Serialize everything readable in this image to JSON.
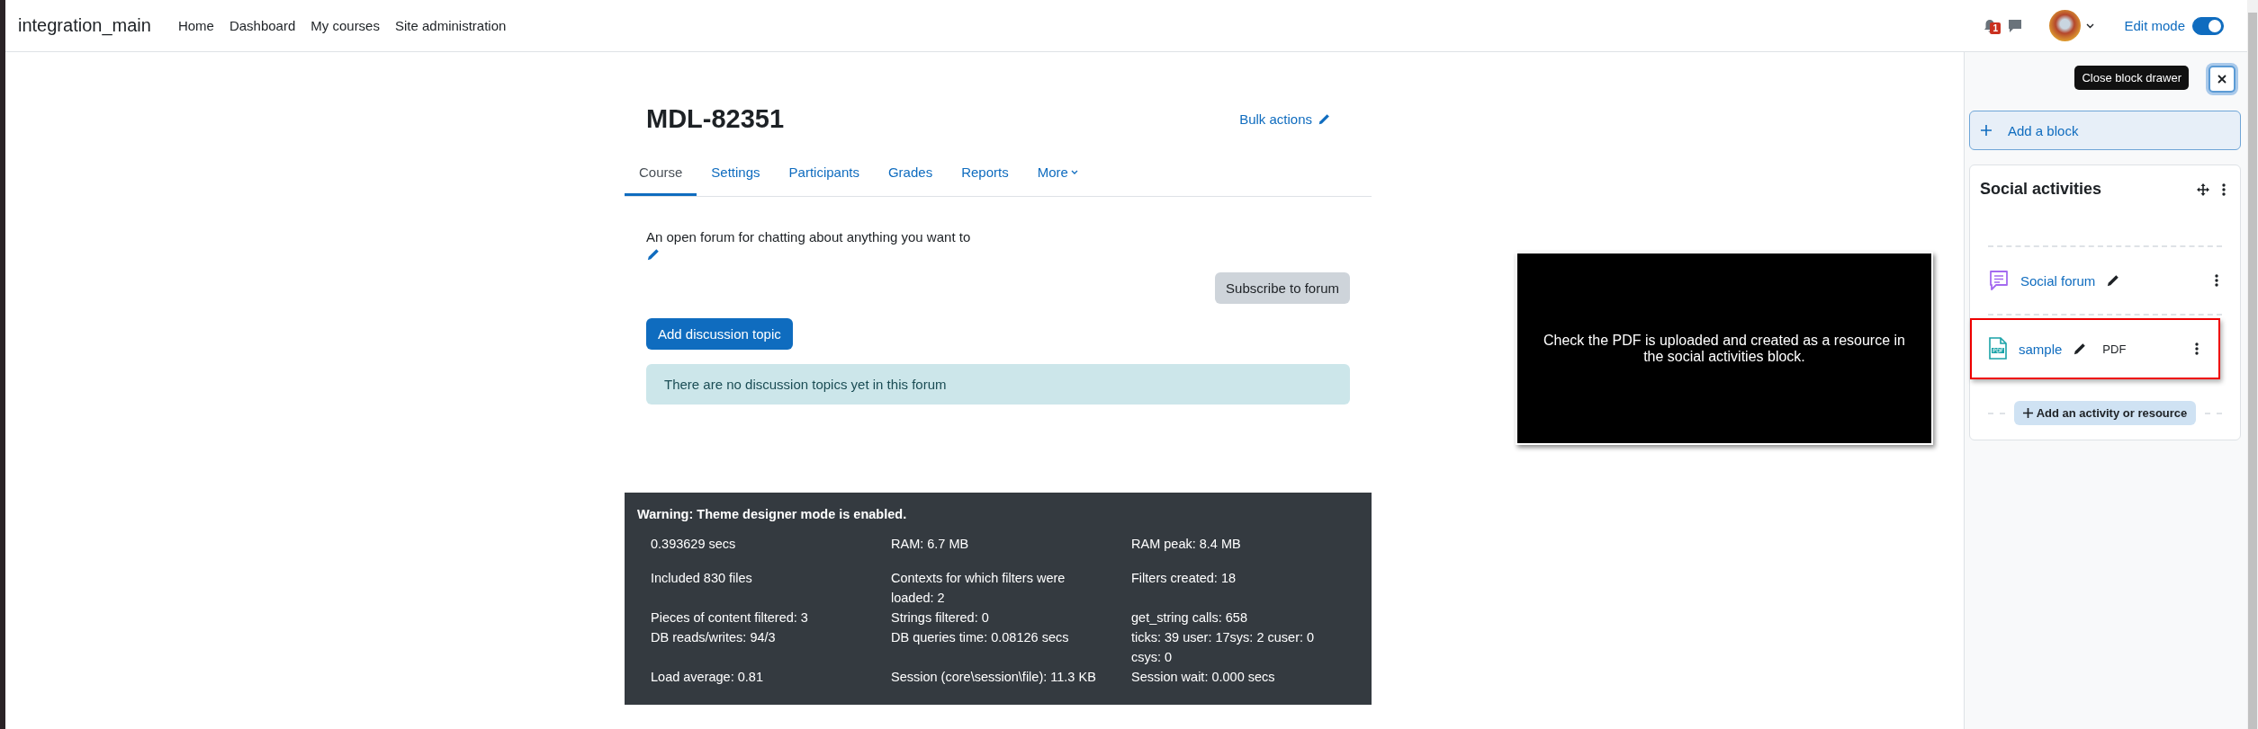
{
  "navbar": {
    "site_name": "integration_main",
    "links": [
      {
        "label": "Home"
      },
      {
        "label": "Dashboard"
      },
      {
        "label": "My courses"
      },
      {
        "label": "Site administration"
      }
    ],
    "notification_count": "1",
    "edit_mode": {
      "label": "Edit mode",
      "on": true
    }
  },
  "page": {
    "title": "MDL-82351",
    "bulk_actions": "Bulk actions",
    "tabs": [
      {
        "label": "Course",
        "selected": true,
        "kind": "plain"
      },
      {
        "label": "Settings",
        "selected": false,
        "kind": "plain"
      },
      {
        "label": "Participants",
        "selected": false,
        "kind": "plain"
      },
      {
        "label": "Grades",
        "selected": false,
        "kind": "plain"
      },
      {
        "label": "Reports",
        "selected": false,
        "kind": "plain"
      },
      {
        "label": "More",
        "selected": false,
        "kind": "menu"
      }
    ],
    "description": "An open forum for chatting about anything you want to",
    "subscribe_button": "Subscribe to forum",
    "add_topic_button": "Add discussion topic",
    "alert": "There are no discussion topics yet in this forum"
  },
  "callout": {
    "text": "Check the PDF is uploaded and created as a resource in the social activities block."
  },
  "debug": {
    "warning": "Warning: Theme designer mode is enabled.",
    "items": [
      "0.393629 secs",
      "RAM: 6.7 MB",
      "RAM peak: 8.4 MB",
      "Included 830 files",
      "Contexts for which filters were loaded: 2",
      "Filters created: 18",
      "Pieces of content filtered: 3",
      "Strings filtered: 0",
      "get_string calls: 658",
      "DB reads/writes: 94/3",
      "DB queries time: 0.08126 secs",
      "ticks: 39 user: 17sys: 2 cuser: 0 csys: 0",
      "Load average: 0.81",
      "Session (core\\session\\file): 11.3 KB",
      "Session wait: 0.000 secs"
    ]
  },
  "drawer": {
    "close_tooltip": "Close block drawer",
    "add_block": "Add a block",
    "block": {
      "title": "Social activities",
      "activities": [
        {
          "name": "Social forum",
          "kind": "forum",
          "highlighted": false
        },
        {
          "name": "sample",
          "kind": "pdf",
          "type_label": "PDF",
          "highlighted": true
        }
      ],
      "add_activity": "Add an activity or resource"
    }
  }
}
